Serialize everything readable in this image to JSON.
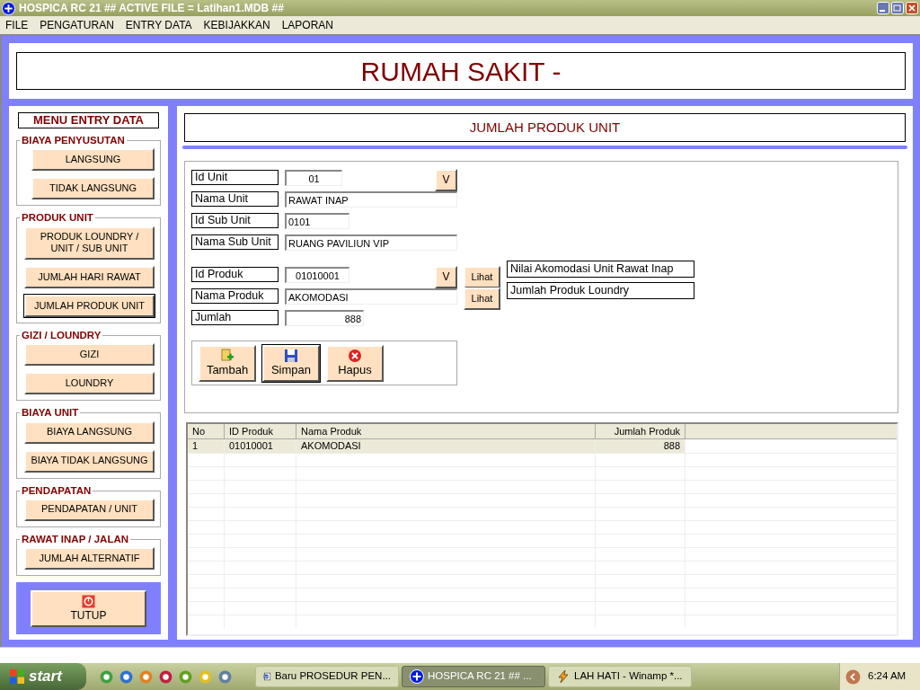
{
  "window": {
    "title": "HOSPICA RC 21 ## ACTIVE FILE = Latihan1.MDB ##"
  },
  "menu": [
    "FILE",
    "PENGATURAN",
    "ENTRY DATA",
    "KEBIJAKKAN",
    "LAPORAN"
  ],
  "header": {
    "title": "RUMAH SAKIT -"
  },
  "sidebar": {
    "title": "MENU ENTRY DATA",
    "groups": [
      {
        "title": "BIAYA PENYUSUTAN",
        "buttons": [
          {
            "label": "LANGSUNG",
            "selected": false
          },
          {
            "label": "TIDAK LANGSUNG",
            "selected": false
          }
        ]
      },
      {
        "title": "PRODUK UNIT",
        "buttons": [
          {
            "label": "PRODUK LOUNDRY / UNIT / SUB UNIT",
            "selected": false
          },
          {
            "label": "JUMLAH HARI RAWAT",
            "selected": false
          },
          {
            "label": "JUMLAH PRODUK UNIT",
            "selected": true
          }
        ]
      },
      {
        "title": "GIZI / LOUNDRY",
        "buttons": [
          {
            "label": "GIZI",
            "selected": false
          },
          {
            "label": "LOUNDRY",
            "selected": false
          }
        ]
      },
      {
        "title": "BIAYA UNIT",
        "buttons": [
          {
            "label": "BIAYA LANGSUNG",
            "selected": false
          },
          {
            "label": "BIAYA TIDAK LANGSUNG",
            "selected": false
          }
        ]
      },
      {
        "title": "PENDAPATAN",
        "buttons": [
          {
            "label": "PENDAPATAN / UNIT",
            "selected": false
          }
        ]
      },
      {
        "title": "RAWAT INAP / JALAN",
        "buttons": [
          {
            "label": "JUMLAH ALTERNATIF",
            "selected": false
          }
        ]
      }
    ],
    "close_button": {
      "label": "TUTUP"
    }
  },
  "form": {
    "title": "JUMLAH PRODUK UNIT",
    "field_groups": [
      {
        "fields": [
          {
            "label": "Id Unit",
            "value": "01",
            "lookup": "V"
          },
          {
            "label": "Nama Unit",
            "value": "RAWAT INAP"
          },
          {
            "label": "Id Sub Unit",
            "value": "0101"
          },
          {
            "label": "Nama Sub Unit",
            "value": "RUANG PAVILIUN VIP"
          }
        ]
      },
      {
        "fields": [
          {
            "label": "Id Produk",
            "value": "01010001",
            "lookup": "V",
            "view": "Lihat",
            "view_caption": "Nilai Akomodasi Unit Rawat Inap"
          },
          {
            "label": "Nama Produk",
            "value": "AKOMODASI",
            "view": "Lihat",
            "view_caption": "Jumlah Produk Loundry"
          },
          {
            "label": "Jumlah",
            "value": "888"
          }
        ]
      }
    ],
    "actions": [
      {
        "label": "Tambah",
        "kind": "add",
        "focused": false
      },
      {
        "label": "Simpan",
        "kind": "save",
        "focused": true
      },
      {
        "label": "Hapus",
        "kind": "delete",
        "focused": false
      }
    ]
  },
  "table": {
    "columns": [
      "No",
      "ID Produk",
      "Nama Produk",
      "Jumlah Produk"
    ],
    "rows": [
      {
        "cells": [
          "1",
          "01010001",
          "AKOMODASI",
          "888"
        ],
        "selected": true
      }
    ]
  },
  "taskbar": {
    "start": "start",
    "tasks": [
      {
        "label": "Baru PROSEDUR PEN...",
        "kind": "word",
        "selected": false
      },
      {
        "label": "HOSPICA RC 21 ## ...",
        "kind": "app",
        "selected": true
      },
      {
        "label": "LAH HATI - Winamp *...",
        "kind": "winamp",
        "selected": false
      }
    ],
    "clock": "6:24 AM"
  }
}
